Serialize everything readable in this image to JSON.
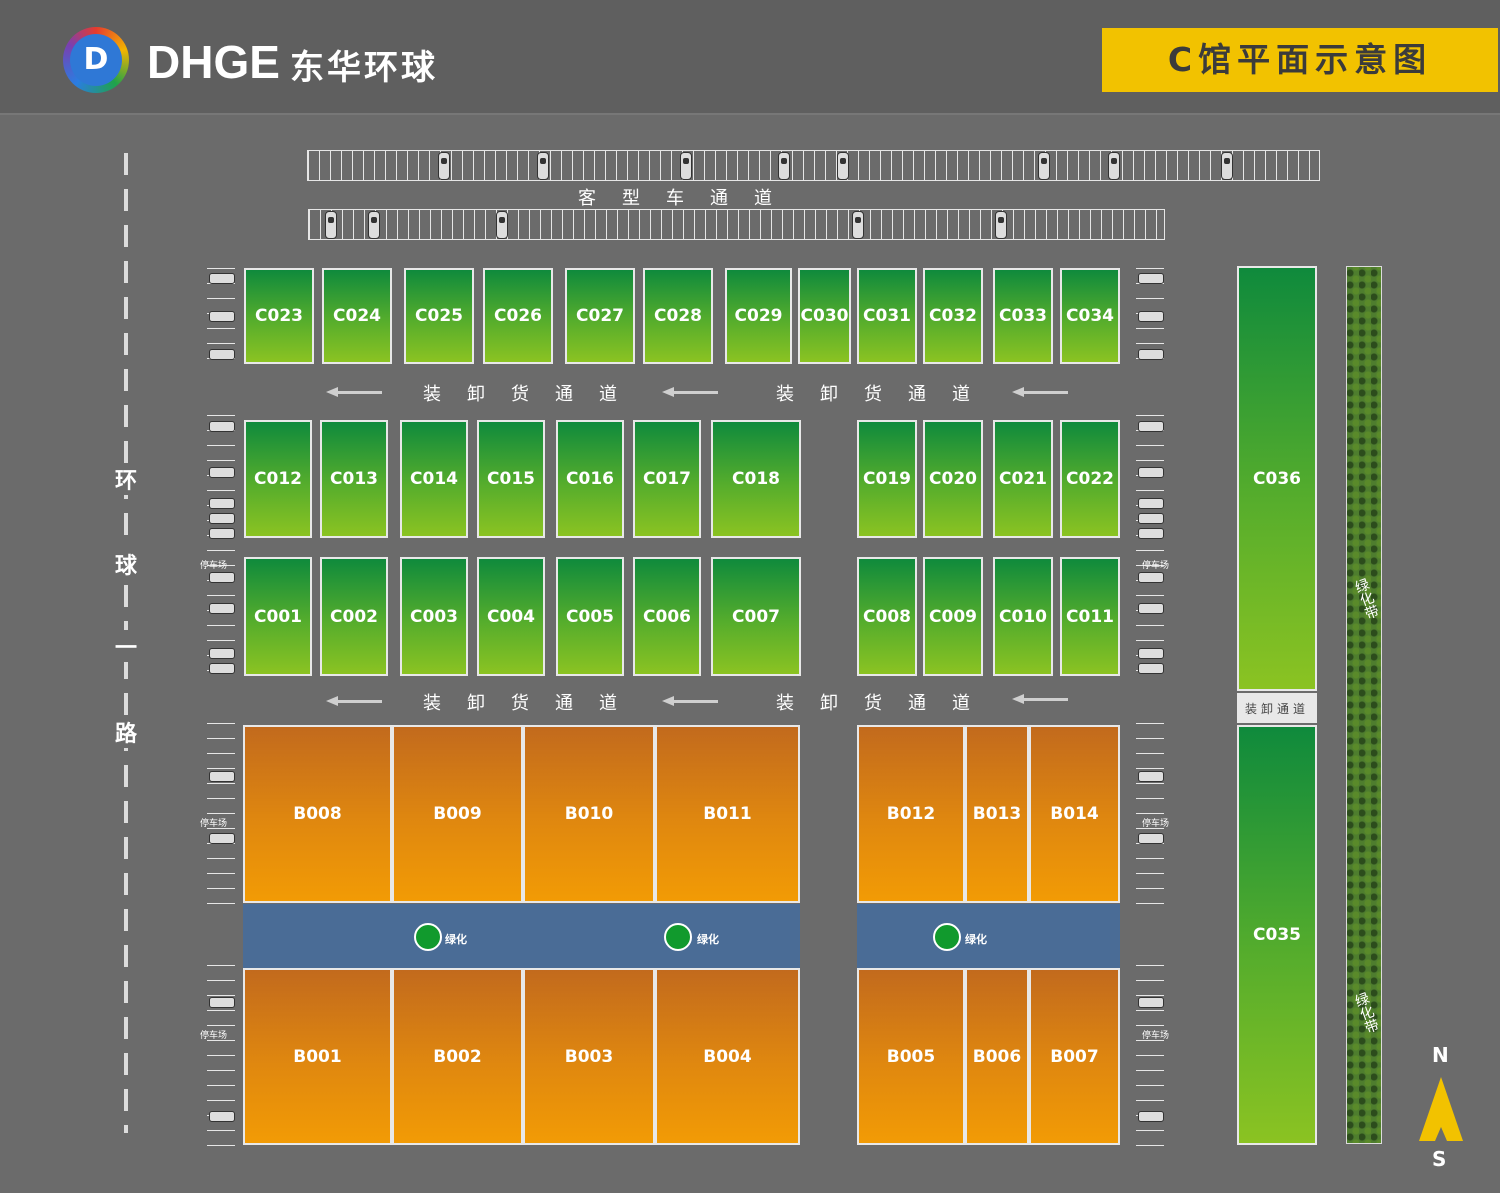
{
  "header": {
    "logo_letter": "D",
    "brand_name": "DHGE",
    "brand_cn": "东华环球",
    "title": "C馆平面示意图"
  },
  "road": {
    "chars": [
      "环",
      "球",
      "一",
      "路"
    ]
  },
  "lanes": {
    "passenger": "客型车通道",
    "cargo": "装卸货通道",
    "cargo_short": "装卸通道"
  },
  "labels": {
    "parking": "停车场",
    "greening": "绿化",
    "greenbelt": "绿化带"
  },
  "compass": {
    "north": "N",
    "south": "S"
  },
  "booths": {
    "c_top": [
      "C023",
      "C024",
      "C025",
      "C026",
      "C027",
      "C028",
      "C029",
      "C030",
      "C031",
      "C032",
      "C033",
      "C034"
    ],
    "c_mid_left": [
      "C012",
      "C013",
      "C014",
      "C015",
      "C016",
      "C017",
      "C018"
    ],
    "c_mid_right": [
      "C019",
      "C020",
      "C021",
      "C022"
    ],
    "c_low_left": [
      "C001",
      "C002",
      "C003",
      "C004",
      "C005",
      "C006",
      "C007"
    ],
    "c_low_right": [
      "C008",
      "C009",
      "C010",
      "C011"
    ],
    "c_tall": [
      "C036",
      "C035"
    ],
    "b_upper_left": [
      "B008",
      "B009",
      "B010",
      "B011"
    ],
    "b_upper_right": [
      "B012",
      "B013",
      "B014"
    ],
    "b_lower_left": [
      "B001",
      "B002",
      "B003",
      "B004"
    ],
    "b_lower_right": [
      "B005",
      "B006",
      "B007"
    ]
  },
  "colors": {
    "c_booth": "#3fa02e",
    "b_booth": "#e48a10",
    "title_bg": "#f2c200",
    "green_band": "#4a6c96"
  }
}
